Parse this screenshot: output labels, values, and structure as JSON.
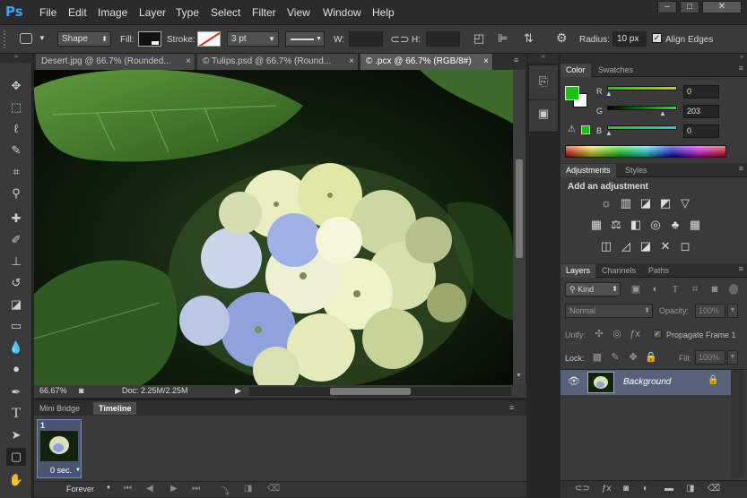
{
  "app": {
    "logo": "Ps"
  },
  "menu": [
    "File",
    "Edit",
    "Image",
    "Layer",
    "Type",
    "Select",
    "Filter",
    "View",
    "Window",
    "Help"
  ],
  "window_controls": {
    "minimize": "–",
    "restore": "□",
    "close": "✕"
  },
  "options": {
    "mode": "Shape",
    "fill_label": "Fill:",
    "stroke_label": "Stroke:",
    "stroke_width": "3 pt",
    "w_label": "W:",
    "h_label": "H:",
    "radius_label": "Radius:",
    "radius_value": "10 px",
    "align_edges": "Align Edges"
  },
  "tabs": [
    {
      "label": "Desert.jpg @ 66.7% (Rounded...",
      "close": "×"
    },
    {
      "label": "© Tulips.psd @ 66.7% (Round...",
      "close": "×"
    },
    {
      "label": "© .pcx @ 66.7% (RGB/8#)",
      "close": "×"
    }
  ],
  "status": {
    "zoom": "66.67%",
    "doc": "Doc: 2.25M/2.25M"
  },
  "timeline": {
    "tab_mini_bridge": "Mini Bridge",
    "tab_timeline": "Timeline",
    "frame_number": "1",
    "frame_delay": "0 sec.",
    "loop": "Forever"
  },
  "color_panel": {
    "tab_color": "Color",
    "tab_swatches": "Swatches",
    "r_label": "R",
    "g_label": "G",
    "b_label": "B",
    "r": "0",
    "g": "203",
    "b": "0",
    "foreground": "#14c40c"
  },
  "adjustments": {
    "tab_adjustments": "Adjustments",
    "tab_styles": "Styles",
    "heading": "Add an adjustment",
    "icons": [
      "☼",
      "▥",
      "◪",
      "◩",
      "▽",
      "▦",
      "⚖",
      "◧",
      "◎",
      "♣",
      "▦",
      "◫",
      "◿",
      "◪",
      "✕",
      "◻"
    ]
  },
  "layers": {
    "tab_layers": "Layers",
    "tab_channels": "Channels",
    "tab_paths": "Paths",
    "kind": "Kind",
    "blend": "Normal",
    "opacity_label": "Opacity:",
    "opacity": "100%",
    "unify_label": "Unify:",
    "propagate": "Propagate Frame 1",
    "lock_label": "Lock:",
    "fill_label": "Fill:",
    "fill": "100%",
    "layer_name": "Background"
  }
}
